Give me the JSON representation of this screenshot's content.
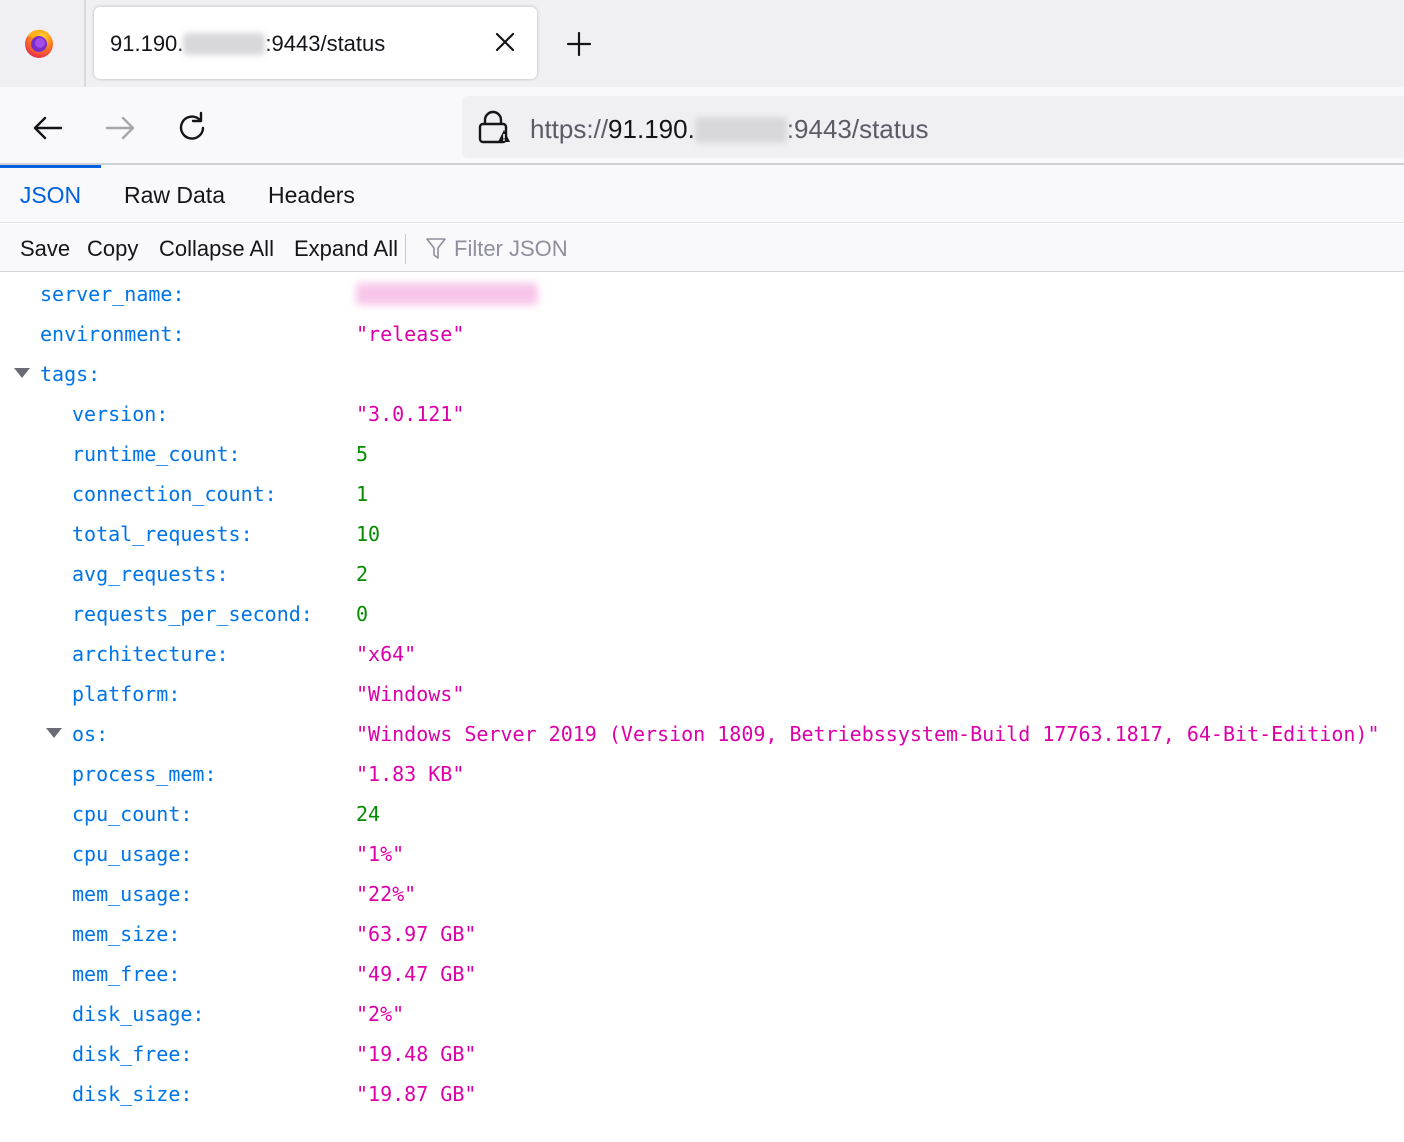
{
  "browser": {
    "tab": {
      "title_prefix": "91.190.",
      "title_suffix": ":9443/status"
    },
    "url": {
      "scheme": "https://",
      "host_prefix": "91.190.",
      "rest": ":9443/status"
    }
  },
  "viewer": {
    "tabs": [
      "JSON",
      "Raw Data",
      "Headers"
    ],
    "toolbar": {
      "save": "Save",
      "copy": "Copy",
      "collapse_all": "Collapse All",
      "expand_all": "Expand All",
      "filter_placeholder": "Filter JSON"
    }
  },
  "json": {
    "top": [
      {
        "key": "server_name:",
        "value": "",
        "type": "string"
      },
      {
        "key": "environment:",
        "value": "\"release\"",
        "type": "string"
      }
    ],
    "tags_key": "tags:",
    "tags": [
      {
        "key": "version:",
        "value": "\"3.0.121\"",
        "type": "string"
      },
      {
        "key": "runtime_count:",
        "value": "5",
        "type": "number"
      },
      {
        "key": "connection_count:",
        "value": "1",
        "type": "number"
      },
      {
        "key": "total_requests:",
        "value": "10",
        "type": "number"
      },
      {
        "key": "avg_requests:",
        "value": "2",
        "type": "number"
      },
      {
        "key": "requests_per_second:",
        "value": "0",
        "type": "number"
      },
      {
        "key": "architecture:",
        "value": "\"x64\"",
        "type": "string"
      },
      {
        "key": "platform:",
        "value": "\"Windows\"",
        "type": "string"
      },
      {
        "key": "os:",
        "value": "\"Windows Server 2019 (Version 1809, Betriebssystem-Build 17763.1817, 64-Bit-Edition)\"",
        "type": "string"
      },
      {
        "key": "process_mem:",
        "value": "\"1.83 KB\"",
        "type": "string"
      },
      {
        "key": "cpu_count:",
        "value": "24",
        "type": "number"
      },
      {
        "key": "cpu_usage:",
        "value": "\"1%\"",
        "type": "string"
      },
      {
        "key": "mem_usage:",
        "value": "\"22%\"",
        "type": "string"
      },
      {
        "key": "mem_size:",
        "value": "\"63.97 GB\"",
        "type": "string"
      },
      {
        "key": "mem_free:",
        "value": "\"49.47 GB\"",
        "type": "string"
      },
      {
        "key": "disk_usage:",
        "value": "\"2%\"",
        "type": "string"
      },
      {
        "key": "disk_free:",
        "value": "\"19.48 GB\"",
        "type": "string"
      },
      {
        "key": "disk_size:",
        "value": "\"19.87 GB\"",
        "type": "string"
      }
    ]
  }
}
